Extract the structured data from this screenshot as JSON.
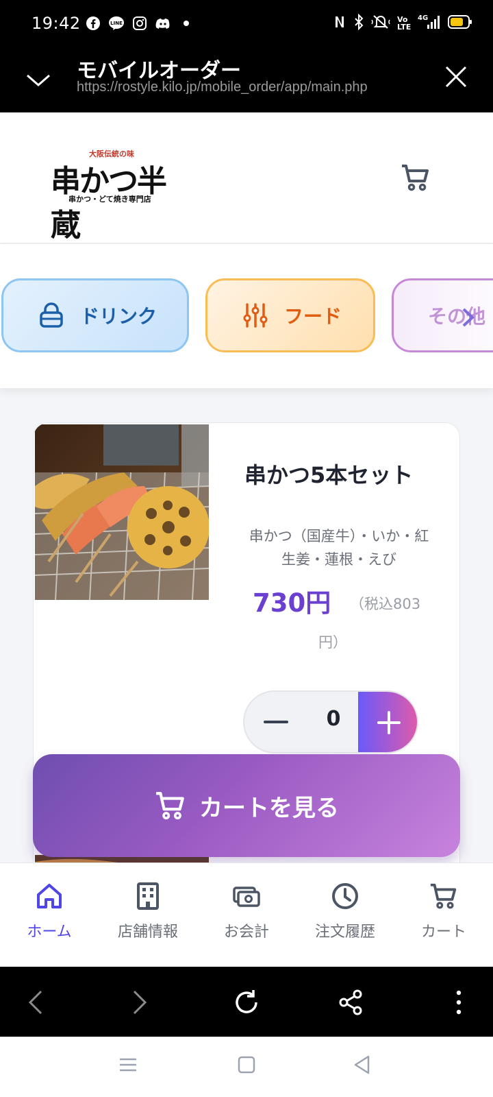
{
  "status_bar": {
    "time": "19:42",
    "left_icons": [
      "facebook-icon",
      "line-icon",
      "instagram-icon",
      "discord-icon",
      "dot-icon"
    ],
    "right_icons": [
      "nfc-icon",
      "bluetooth-icon",
      "mute-icon",
      "volte-icon",
      "signal-4g-icon",
      "battery-icon"
    ],
    "network_label": "4G",
    "volte_label": "Vo LTE"
  },
  "browser_title": {
    "title": "モバイルオーダー",
    "url": "https://rostyle.kilo.jp/mobile_order/app/main.php"
  },
  "header": {
    "logo_top": "大阪伝統の味",
    "logo_main": "串かつ半蔵",
    "logo_bottom": "串かつ・どて焼き専門店"
  },
  "categories": [
    {
      "label": "ドリンク",
      "icon": "bag-icon"
    },
    {
      "label": "フード",
      "icon": "utensils-icon"
    },
    {
      "label": "その他",
      "icon": "chevron-right-icon"
    }
  ],
  "product": {
    "name": "串かつ5本セット",
    "description": "串かつ（国産牛）・いか・紅生姜・蓮根・えび",
    "price": "730円",
    "tax_part1": "（税込803",
    "tax_part2": "円）",
    "quantity": "0"
  },
  "cart_button": {
    "label": "カートを見る"
  },
  "bottom_nav": [
    {
      "label": "ホーム",
      "icon": "home-icon",
      "active": true
    },
    {
      "label": "店舗情報",
      "icon": "building-icon",
      "active": false
    },
    {
      "label": "お会計",
      "icon": "money-icon",
      "active": false
    },
    {
      "label": "注文履歴",
      "icon": "clock-icon",
      "active": false
    },
    {
      "label": "カート",
      "icon": "cart-icon",
      "active": false
    }
  ],
  "colors": {
    "accent": "#4f46e5",
    "price": "#6b3fd0",
    "drink": "#1b5fa8",
    "food": "#e05d12"
  }
}
